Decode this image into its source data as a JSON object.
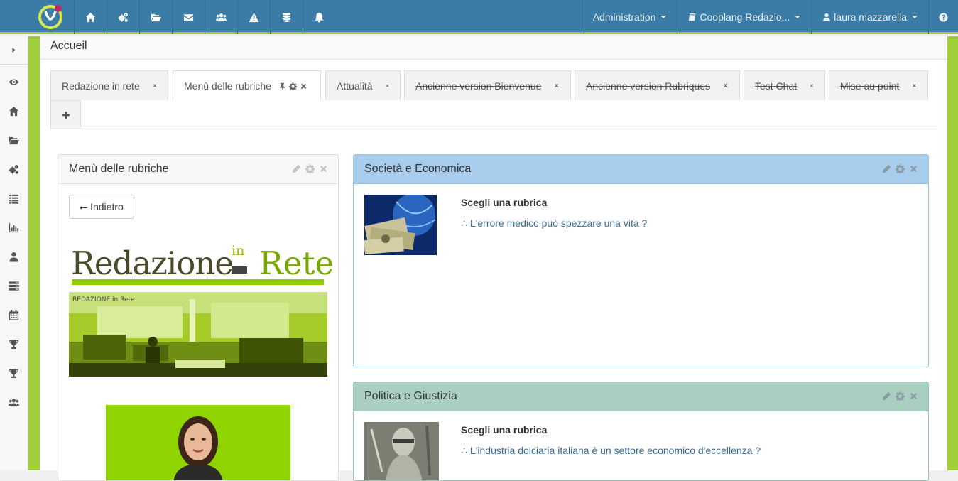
{
  "navbar": {
    "menus": [
      {
        "label": "Administration",
        "icon": "none"
      },
      {
        "label": "Cooplang Redazio...",
        "icon": "book-icon"
      },
      {
        "label": "laura mazzarella",
        "icon": "user-icon"
      }
    ],
    "icons": [
      "home-icon",
      "cogs-icon",
      "folder-open-icon",
      "envelope-icon",
      "users-icon",
      "warning-icon",
      "database-icon",
      "bell-icon"
    ],
    "help_icon": "question-circle-icon",
    "colors": {
      "bar": "#3a7ca5",
      "accent": "#a0cf3a"
    }
  },
  "sidebar": {
    "icons": [
      "eye-icon",
      "home-icon",
      "folder-open-icon",
      "cogs-icon",
      "list-icon",
      "bar-chart-icon",
      "user-icon",
      "server-icon",
      "calendar-icon",
      "trophy-icon",
      "trophy-icon",
      "users-icon"
    ]
  },
  "page": {
    "title": "Accueil"
  },
  "tabs": [
    {
      "label": "Redazione in rete",
      "struck": false
    },
    {
      "label": "Menù delle rubriche",
      "struck": false,
      "active": true
    },
    {
      "label": "Attualità",
      "struck": false
    },
    {
      "label": "Ancienne version Bienvenue ",
      "struck": true
    },
    {
      "label": "Ancienne version Rubriques ",
      "struck": true
    },
    {
      "label": "Test Chat ",
      "struck": true
    },
    {
      "label": "Mise au point ",
      "struck": true
    }
  ],
  "panels": {
    "menu": {
      "title": "Menù delle rubriche",
      "back_label": "⭠ Indietro",
      "logo_text": "Redazione",
      "logo_small": "in",
      "logo_text2": "Rete",
      "photo_caption": "REDAZIONE in Rete"
    },
    "societa": {
      "title": "Società e Economica",
      "heading": "Scegli una rubrica",
      "bullet": "∴",
      "link": "L'errore medico può spezzare una vita ?"
    },
    "politica": {
      "title": "Politica e Giustizia",
      "heading": "Scegli una rubrica",
      "bullet": "∴",
      "link": "L'industria dolciaria italiana è un settore economico d'eccellenza ?"
    }
  }
}
